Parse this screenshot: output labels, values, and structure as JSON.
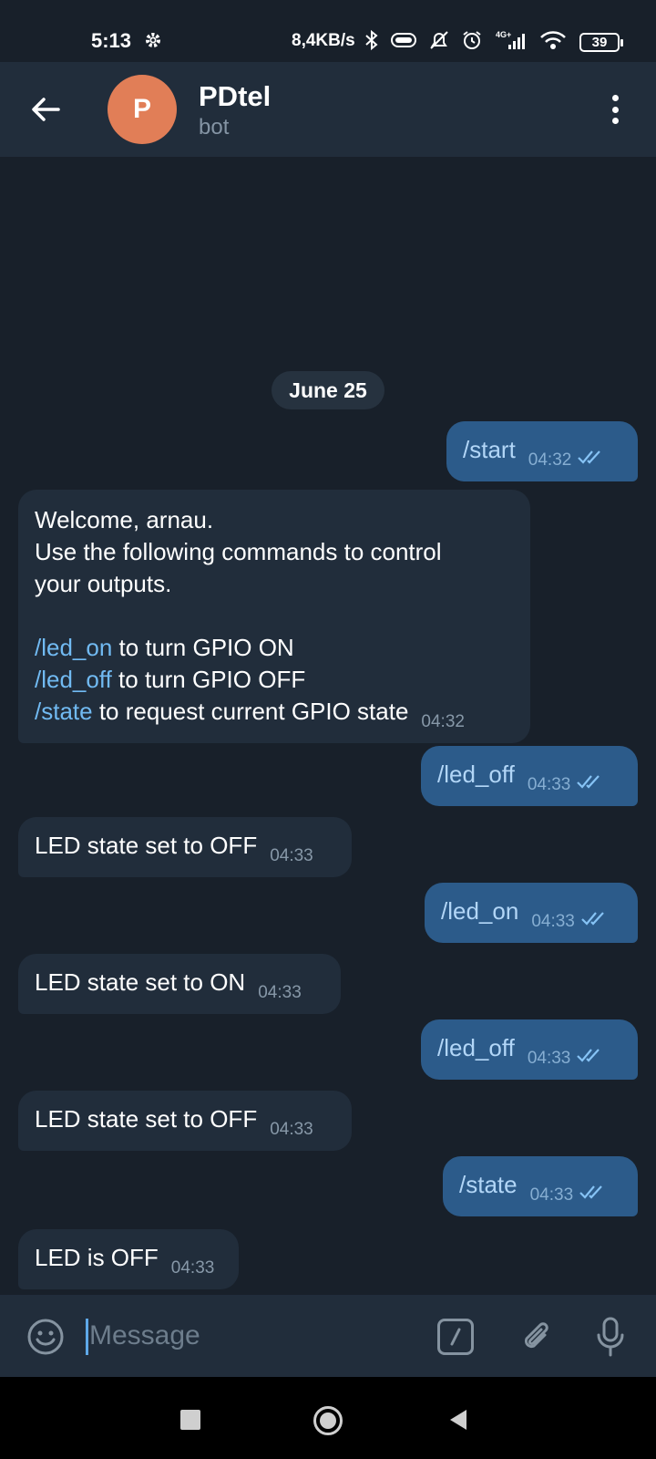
{
  "status_bar": {
    "time": "5:13",
    "network_speed": "8,4KB/s",
    "battery": "39",
    "icons": [
      "gear-icon",
      "bluetooth-icon",
      "vibrate-icon",
      "silent-icon",
      "alarm-icon",
      "signal-4g-icon",
      "wifi-icon",
      "battery-icon"
    ]
  },
  "header": {
    "title": "PDtel",
    "subtitle": "bot",
    "avatar_letter": "P",
    "avatar_color": "#e17e57"
  },
  "date_separator": "June 25",
  "messages": [
    {
      "dir": "out",
      "text": "/start",
      "time": "04:32"
    },
    {
      "dir": "in",
      "lines": [
        {
          "parts": [
            {
              "text": "Welcome, arnau."
            }
          ]
        },
        {
          "parts": [
            {
              "text": "Use the following commands to control"
            }
          ]
        },
        {
          "parts": [
            {
              "text": "your outputs."
            }
          ]
        },
        {
          "parts": []
        },
        {
          "parts": [
            {
              "text": "/led_on",
              "cmd": true
            },
            {
              "text": " to turn GPIO ON"
            }
          ]
        },
        {
          "parts": [
            {
              "text": "/led_off",
              "cmd": true
            },
            {
              "text": " to turn GPIO OFF"
            }
          ]
        },
        {
          "parts": [
            {
              "text": "/state",
              "cmd": true
            },
            {
              "text": " to request current GPIO state"
            }
          ]
        }
      ],
      "time": "04:32"
    },
    {
      "dir": "out",
      "text": "/led_off",
      "time": "04:33"
    },
    {
      "dir": "in",
      "text": "LED state set to OFF",
      "time": "04:33"
    },
    {
      "dir": "out",
      "text": "/led_on",
      "time": "04:33"
    },
    {
      "dir": "in",
      "text": "LED state set to ON",
      "time": "04:33"
    },
    {
      "dir": "out",
      "text": "/led_off",
      "time": "04:33"
    },
    {
      "dir": "in",
      "text": "LED state set to OFF",
      "time": "04:33"
    },
    {
      "dir": "out",
      "text": "/state",
      "time": "04:33"
    },
    {
      "dir": "in",
      "text": "LED is OFF",
      "time": "04:33"
    }
  ],
  "input": {
    "placeholder": "Message"
  },
  "colors": {
    "background": "#18202a",
    "header": "#212d3b",
    "outgoing_bubble": "#2c5b8a",
    "incoming_bubble": "#212d3b",
    "command_link": "#71baf2"
  }
}
